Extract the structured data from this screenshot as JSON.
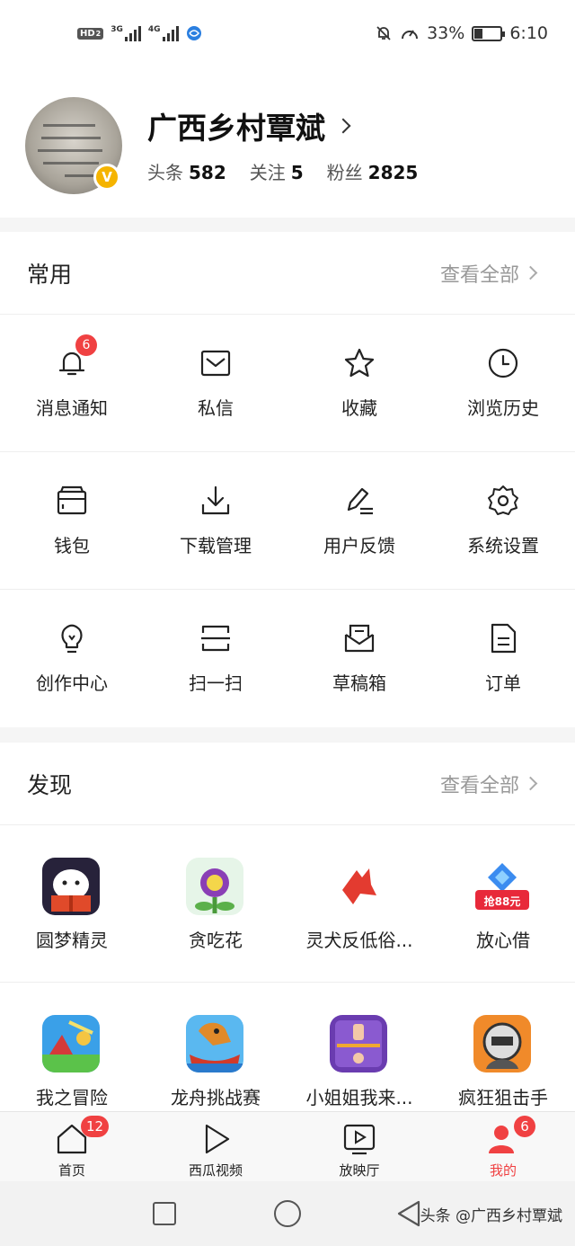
{
  "status_bar": {
    "hd_label": "HD",
    "hd_sub": "2",
    "net1": "3G",
    "net2": "4G",
    "battery_text": "33%",
    "battery_level": 0.33,
    "time": "6:10"
  },
  "profile": {
    "name": "广西乡村覃斌",
    "verified_mark": "V",
    "stats": [
      {
        "label": "头条",
        "value": "582"
      },
      {
        "label": "关注",
        "value": "5"
      },
      {
        "label": "粉丝",
        "value": "2825"
      }
    ]
  },
  "common": {
    "title": "常用",
    "view_all": "查看全部",
    "items": [
      {
        "label": "消息通知",
        "icon": "bell-icon",
        "badge": "6"
      },
      {
        "label": "私信",
        "icon": "mail-icon"
      },
      {
        "label": "收藏",
        "icon": "star-icon"
      },
      {
        "label": "浏览历史",
        "icon": "clock-icon"
      },
      {
        "label": "钱包",
        "icon": "wallet-icon"
      },
      {
        "label": "下载管理",
        "icon": "download-icon"
      },
      {
        "label": "用户反馈",
        "icon": "pen-icon"
      },
      {
        "label": "系统设置",
        "icon": "gear-icon"
      },
      {
        "label": "创作中心",
        "icon": "lightbulb-icon"
      },
      {
        "label": "扫一扫",
        "icon": "scan-icon"
      },
      {
        "label": "草稿箱",
        "icon": "draft-box-icon"
      },
      {
        "label": "订单",
        "icon": "document-icon"
      }
    ]
  },
  "discover": {
    "title": "发现",
    "view_all": "查看全部",
    "apps": [
      {
        "label": "圆梦精灵",
        "icon": "dream-spirit-app-icon"
      },
      {
        "label": "贪吃花",
        "icon": "greedy-flower-app-icon"
      },
      {
        "label": "灵犬反低俗...",
        "icon": "dog-app-icon"
      },
      {
        "label": "放心借",
        "icon": "loan-app-icon",
        "promo": "抢88元"
      },
      {
        "label": "我之冒险",
        "icon": "adventure-app-icon"
      },
      {
        "label": "龙舟挑战赛",
        "icon": "dragon-boat-app-icon"
      },
      {
        "label": "小姐姐我来...",
        "icon": "puzzle-girl-app-icon"
      },
      {
        "label": "疯狂狙击手",
        "icon": "sniper-app-icon"
      }
    ]
  },
  "tabbar": {
    "tabs": [
      {
        "label": "首页",
        "icon": "home-icon",
        "badge": "12"
      },
      {
        "label": "西瓜视频",
        "icon": "play-icon"
      },
      {
        "label": "放映厅",
        "icon": "tv-icon"
      },
      {
        "label": "我的",
        "icon": "user-icon",
        "badge": "6",
        "active": true
      }
    ]
  },
  "watermark": "头条 @广西乡村覃斌",
  "colors": {
    "accent": "#f04142",
    "badge_gold": "#f5b400"
  }
}
